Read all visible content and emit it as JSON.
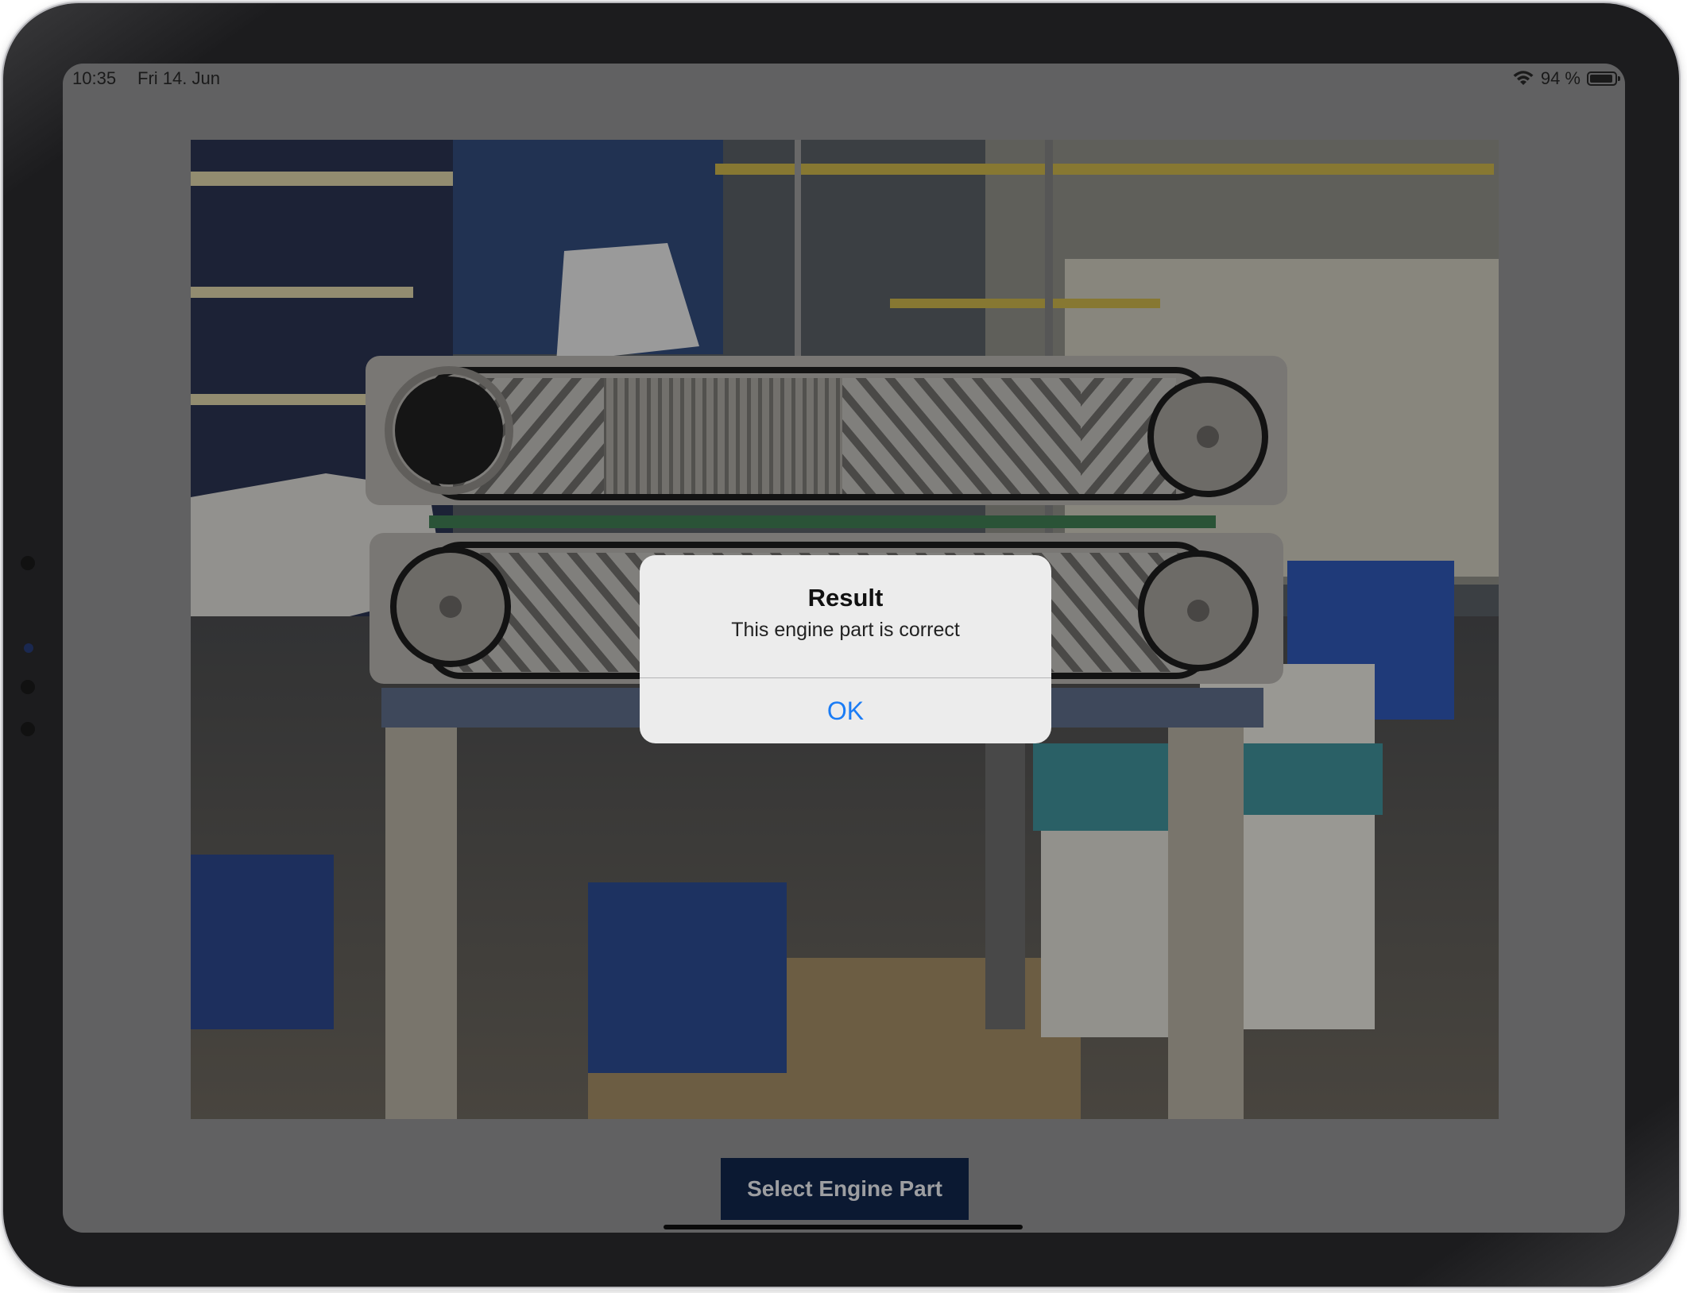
{
  "status_bar": {
    "time": "10:35",
    "date": "Fri 14. Jun",
    "battery_text": "94 %",
    "battery_level": 0.94,
    "wifi_icon": "wifi-icon"
  },
  "main": {
    "photo_description_icon": "camera-photo",
    "select_button_label": "Select Engine Part"
  },
  "alert": {
    "title": "Result",
    "message": "This engine part is correct",
    "ok_label": "OK"
  },
  "colors": {
    "accent": "#1a7cf5",
    "button_bg": "#11254a",
    "screen_bg": "#8f8f91"
  }
}
